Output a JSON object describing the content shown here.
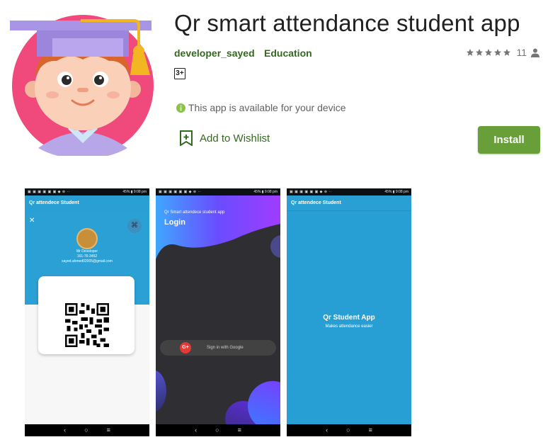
{
  "app": {
    "title": "Qr smart attendance student app",
    "developer": "developer_sayed",
    "category": "Education",
    "rating_count": "11",
    "age_rating": "3+",
    "availability": "This app is available for your device",
    "wishlist_label": "Add to Wishlist",
    "install_label": "Install",
    "stars_filled": 5
  },
  "colors": {
    "accent_green": "#33691e",
    "install_bg": "#689f38",
    "icon_bg": "#f04a7c",
    "screenshot_blue": "#2ba0d5"
  },
  "icons": [
    "star-icon",
    "person-icon",
    "info-icon",
    "wishlist-icon"
  ],
  "screenshots": {
    "shot1": {
      "appbar_title": "Qr attendece Student",
      "close_glyph": "✕",
      "user_name": "Mr Developer",
      "user_id": "161-76-3452",
      "user_email": "sayed.ahmed02005@gmail.com"
    },
    "shot2": {
      "subtitle": "Qr Smart attendece student app",
      "title": "Login",
      "google_glyph": "G+",
      "google_label": "Sign in with Google"
    },
    "shot3": {
      "appbar_title": "Qr attendece Student",
      "center_title": "Qr Student App",
      "center_subtitle": "Makes attendance easier"
    },
    "statusbar_right": "45% ▮ 9:08 pm",
    "nav": {
      "back": "‹",
      "home": "○",
      "recents": "≡"
    }
  }
}
